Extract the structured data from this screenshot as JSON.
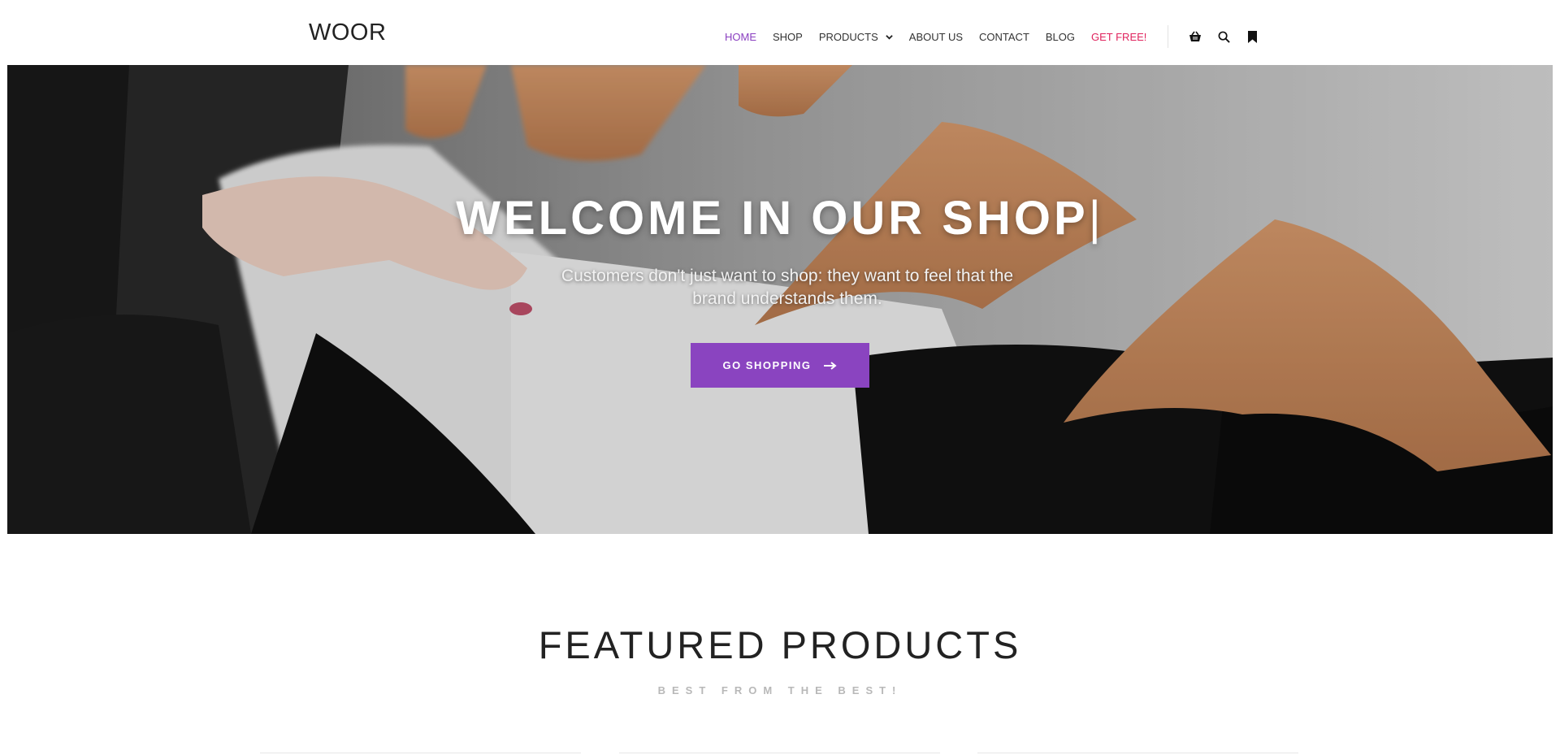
{
  "brand": {
    "logo": "WOOR"
  },
  "nav": {
    "items": [
      {
        "label": "HOME",
        "active": true
      },
      {
        "label": "SHOP"
      },
      {
        "label": "PRODUCTS",
        "dropdown": true
      },
      {
        "label": "ABOUT US"
      },
      {
        "label": "CONTACT"
      },
      {
        "label": "BLOG"
      },
      {
        "label": "GET FREE!",
        "promo": true
      }
    ],
    "icons": [
      "basket-icon",
      "search-icon",
      "bookmark-icon"
    ]
  },
  "hero": {
    "title": "WELCOME IN OUR SHOP",
    "caret": "|",
    "subtitle": "Customers don't just want to shop: they want to feel that the brand understands them.",
    "button_label": "GO SHOPPING"
  },
  "featured": {
    "title": "FEATURED PRODUCTS",
    "subtitle": "BEST FROM THE BEST!"
  },
  "colors": {
    "accent": "#8a44c0",
    "nav_active": "#8a3fc0",
    "promo": "#e0245e"
  }
}
